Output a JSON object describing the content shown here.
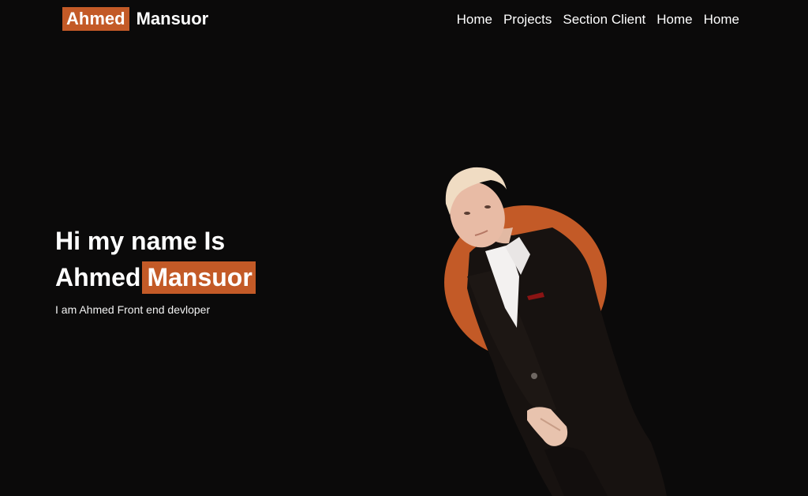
{
  "nav": {
    "logo_highlight": "Ahmed",
    "logo_rest": "Mansuor",
    "links": [
      "Home",
      "Projects",
      "Section Client",
      "Home",
      "Home"
    ]
  },
  "hero": {
    "line1": "Hi my name Is",
    "first_name": "Ahmed",
    "last_name": "Mansuor",
    "tagline": "I am Ahmed Front end devloper"
  },
  "colors": {
    "accent": "#c35a27",
    "background": "#0b0a0a"
  },
  "portrait": {
    "icon": "person-portrait"
  }
}
